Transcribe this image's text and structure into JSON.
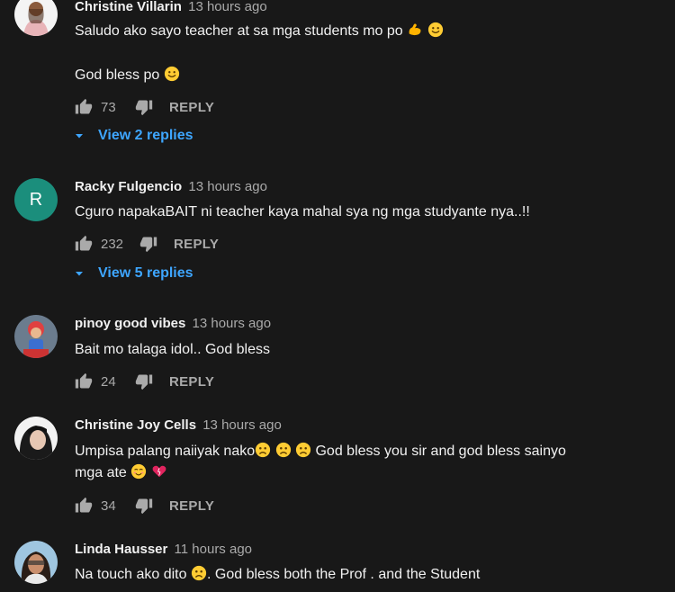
{
  "comments": [
    {
      "author": "Christine Villarin",
      "time": "13 hours ago",
      "line1": "Saludo ako sayo teacher at sa mga students mo po",
      "line2": "God bless po",
      "likes": "73",
      "reply_label": "REPLY",
      "view_replies": "View 2 replies"
    },
    {
      "author": "Racky Fulgencio",
      "time": "13 hours ago",
      "avatar_letter": "R",
      "line1": "Cguro napakaBAIT ni teacher kaya mahal sya ng mga studyante nya..!!",
      "likes": "232",
      "reply_label": "REPLY",
      "view_replies": "View 5 replies"
    },
    {
      "author": "pinoy good vibes",
      "time": "13 hours ago",
      "line1": "Bait mo talaga idol.. God bless",
      "likes": "24",
      "reply_label": "REPLY"
    },
    {
      "author": "Christine Joy Cells",
      "time": "13 hours ago",
      "line1a": "Umpisa palang naiiyak nako",
      "line1b": "God bless you sir and god bless sainyo",
      "line2": "mga ate",
      "likes": "34",
      "reply_label": "REPLY"
    },
    {
      "author": "Linda Hausser",
      "time": "11 hours ago",
      "line1a": "Na touch ako dito",
      "line1b": ". God bless both the Prof . and the Student"
    }
  ]
}
